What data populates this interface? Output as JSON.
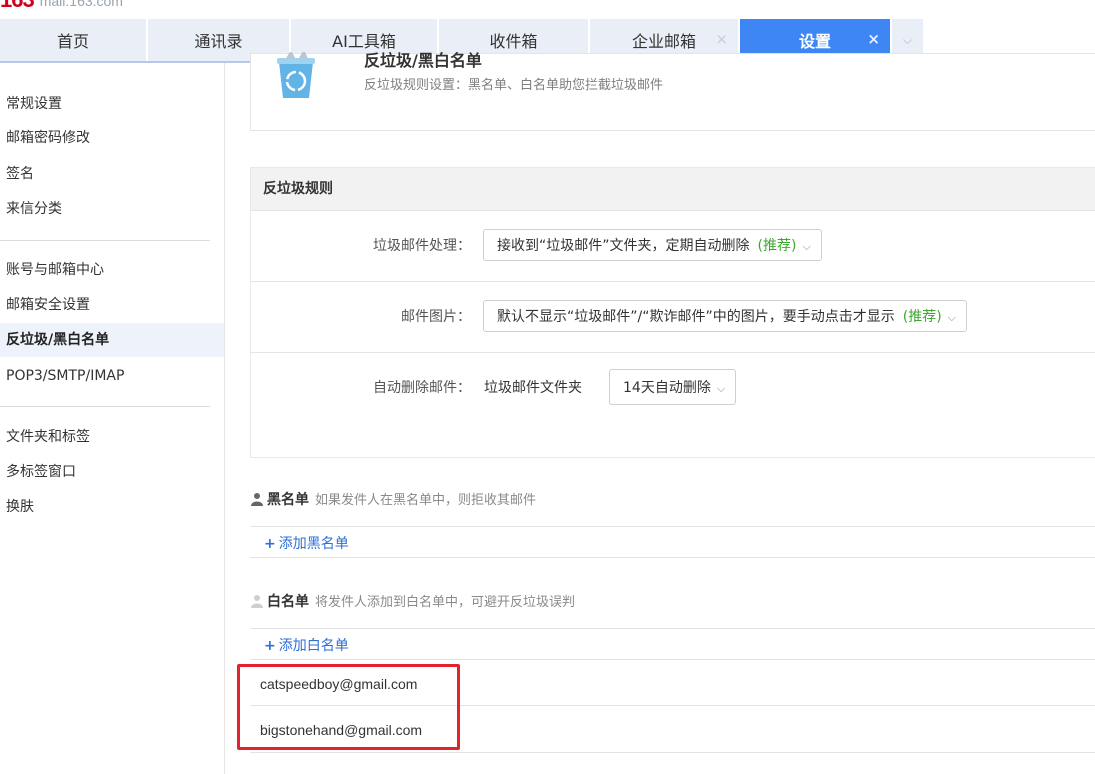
{
  "logo": {
    "mark": "163",
    "domain": "mail.163.com"
  },
  "tabs": [
    {
      "label": "首页"
    },
    {
      "label": "通讯录"
    },
    {
      "label": "AI工具箱"
    },
    {
      "label": "收件箱"
    },
    {
      "label": "企业邮箱",
      "close": "×"
    },
    {
      "label": "设置",
      "close": "×",
      "active": true
    }
  ],
  "tab_more": "⌵",
  "sidebar": {
    "group1": [
      "常规设置",
      "邮箱密码修改",
      "签名",
      "来信分类"
    ],
    "group2": [
      "账号与邮箱中心",
      "邮箱安全设置",
      "反垃圾/黑白名单",
      "POP3/SMTP/IMAP"
    ],
    "group3": [
      "文件夹和标签",
      "多标签窗口",
      "换肤"
    ],
    "active": "反垃圾/黑白名单"
  },
  "header": {
    "title": "反垃圾/黑白名单",
    "desc": "反垃圾规则设置：黑名单、白名单助您拦截垃圾邮件"
  },
  "rules": {
    "heading": "反垃圾规则",
    "spam_handling": {
      "label": "垃圾邮件处理：",
      "value": "接收到“垃圾邮件”文件夹，定期自动删除",
      "tag": "(推荐)"
    },
    "images": {
      "label": "邮件图片：",
      "value": "默认不显示“垃圾邮件”/“欺诈邮件”中的图片，要手动点击才显示",
      "tag": "(推荐)"
    },
    "auto_delete": {
      "label": "自动删除邮件：",
      "folder": "垃圾邮件文件夹",
      "value": "14天自动删除"
    }
  },
  "blacklist": {
    "title": "黑名单",
    "desc": "如果发件人在黑名单中，则拒收其邮件",
    "add": "添加黑名单"
  },
  "whitelist": {
    "title": "白名单",
    "desc": "将发件人添加到白名单中，可避开反垃圾误判",
    "add": "添加白名单",
    "entries": [
      "catspeedboy@gmail.com",
      "bigstonehand@gmail.com"
    ]
  },
  "colors": {
    "accent": "#3f86f5",
    "recommend": "#3ca82f",
    "link": "#2c6fd8",
    "highlight": "#e2232b"
  }
}
